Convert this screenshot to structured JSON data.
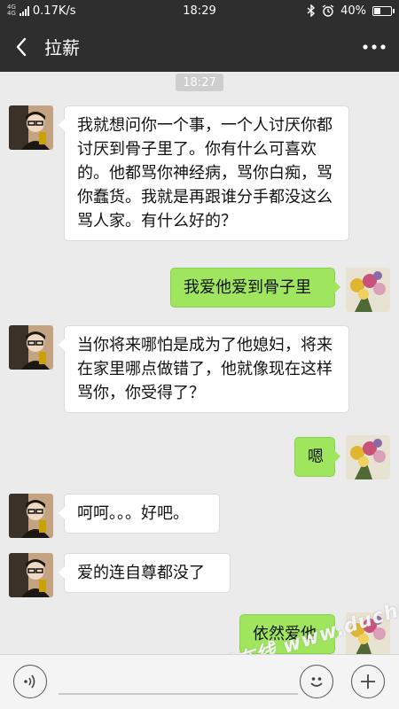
{
  "status_bar": {
    "network_top": "4G",
    "network_bottom": "4G",
    "speed": "0.17K/s",
    "time": "18:29",
    "battery": "40%",
    "battery_level": 0.4,
    "icons": [
      "signal-icon",
      "bluetooth-icon",
      "alarm-icon",
      "battery-icon"
    ]
  },
  "header": {
    "title": "拉薪",
    "back_icon": "back-arrow-icon",
    "more_icon": "more-dots-icon"
  },
  "chat": {
    "timestamp": "18:27",
    "messages": [
      {
        "side": "left",
        "text": "我就想问你一个事，一个人讨厌你都讨厌到骨子里了。你有什么可喜欢的。他都骂你神经病，骂你白痴，骂你蠢货。我就是再跟谁分手都没这么骂人家。有什么好的？"
      },
      {
        "side": "right",
        "text": "我爱他爱到骨子里"
      },
      {
        "side": "left",
        "text": "当你将来哪怕是成为了他媳妇，将来在家里哪点做错了，他就像现在这样骂你，你受得了？"
      },
      {
        "side": "right",
        "text": "嗯"
      },
      {
        "side": "left",
        "text": "呵呵。。。好吧。"
      },
      {
        "side": "left",
        "text": "爱的连自尊都没了"
      },
      {
        "side": "right",
        "text": "依然爱他"
      }
    ],
    "watermark": "都昌在线 www.duchang.org"
  },
  "input_bar": {
    "voice_icon": "voice-icon",
    "emoji_icon": "emoji-icon",
    "add_icon": "plus-icon"
  },
  "colors": {
    "header_bg": "#2e2e2e",
    "chat_bg": "#ebebeb",
    "sent_bubble": "#9fe65e",
    "received_bubble": "#ffffff"
  }
}
